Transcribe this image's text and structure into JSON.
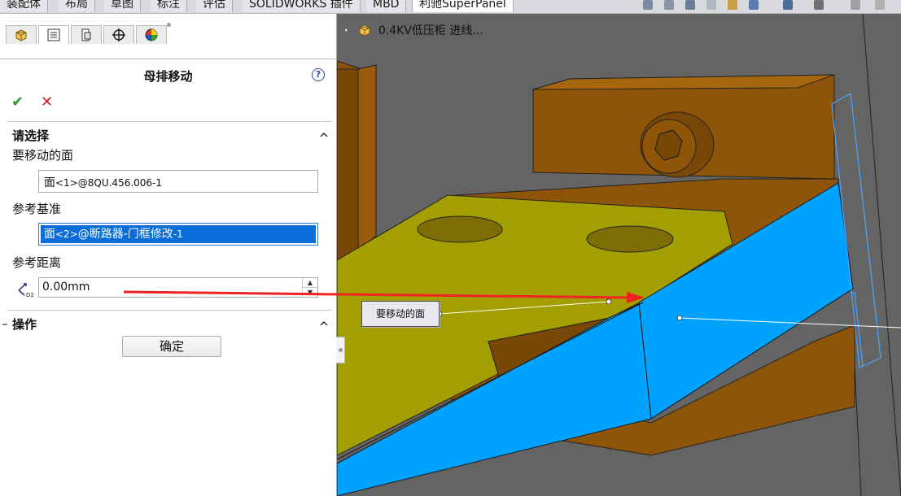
{
  "ribbon": {
    "tabs": [
      "装配体",
      "布局",
      "草图",
      "标注",
      "评估",
      "SOLIDWORKS 插件",
      "MBD",
      "利驰SuperPanel"
    ],
    "active_tab": "利驰SuperPanel"
  },
  "feature_tree": {
    "assembly_name": "0.4KV低压柜 进线..."
  },
  "property_manager": {
    "title": "母排移动",
    "help_icon": "?",
    "ok_icon": "✔",
    "cancel_icon": "✕",
    "section_select": {
      "title": "请选择",
      "face_to_move_label": "要移动的面",
      "face_to_move_value_main": "面",
      "face_to_move_value_tag": "<1>",
      "face_to_move_value_rest": "@8QU.456.006-1",
      "reference_label": "参考基准",
      "reference_value_main": "面",
      "reference_value_tag": "<2>",
      "reference_value_rest": "@断路器-门框修改",
      "reference_value_suffix": "-1",
      "distance_label": "参考距离",
      "distance_value": "0.00mm"
    },
    "section_operation": {
      "title": "操作",
      "confirm_button": "确定"
    }
  },
  "viewport": {
    "callout_label": "要移动的面"
  },
  "colors": {
    "brown_body": "#9a5a0a",
    "olive_busbar": "#a39f00",
    "blue_selected_face": "#00a2ff",
    "background_gray": "#646464",
    "arrow_red": "#ee2222"
  }
}
